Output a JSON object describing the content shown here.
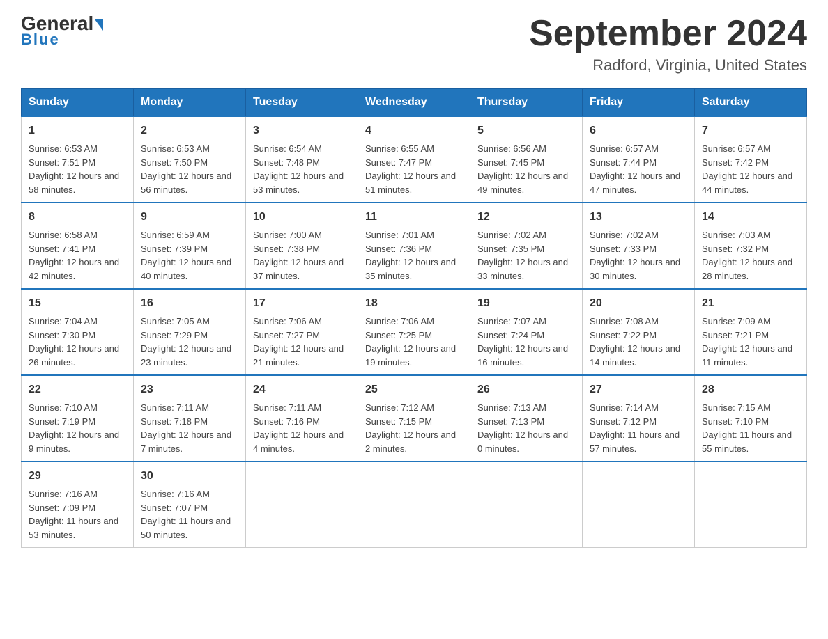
{
  "header": {
    "logo_general": "General",
    "logo_blue": "Blue",
    "month_year": "September 2024",
    "location": "Radford, Virginia, United States"
  },
  "days_of_week": [
    "Sunday",
    "Monday",
    "Tuesday",
    "Wednesday",
    "Thursday",
    "Friday",
    "Saturday"
  ],
  "weeks": [
    [
      {
        "day": "1",
        "sunrise": "6:53 AM",
        "sunset": "7:51 PM",
        "daylight": "12 hours and 58 minutes."
      },
      {
        "day": "2",
        "sunrise": "6:53 AM",
        "sunset": "7:50 PM",
        "daylight": "12 hours and 56 minutes."
      },
      {
        "day": "3",
        "sunrise": "6:54 AM",
        "sunset": "7:48 PM",
        "daylight": "12 hours and 53 minutes."
      },
      {
        "day": "4",
        "sunrise": "6:55 AM",
        "sunset": "7:47 PM",
        "daylight": "12 hours and 51 minutes."
      },
      {
        "day": "5",
        "sunrise": "6:56 AM",
        "sunset": "7:45 PM",
        "daylight": "12 hours and 49 minutes."
      },
      {
        "day": "6",
        "sunrise": "6:57 AM",
        "sunset": "7:44 PM",
        "daylight": "12 hours and 47 minutes."
      },
      {
        "day": "7",
        "sunrise": "6:57 AM",
        "sunset": "7:42 PM",
        "daylight": "12 hours and 44 minutes."
      }
    ],
    [
      {
        "day": "8",
        "sunrise": "6:58 AM",
        "sunset": "7:41 PM",
        "daylight": "12 hours and 42 minutes."
      },
      {
        "day": "9",
        "sunrise": "6:59 AM",
        "sunset": "7:39 PM",
        "daylight": "12 hours and 40 minutes."
      },
      {
        "day": "10",
        "sunrise": "7:00 AM",
        "sunset": "7:38 PM",
        "daylight": "12 hours and 37 minutes."
      },
      {
        "day": "11",
        "sunrise": "7:01 AM",
        "sunset": "7:36 PM",
        "daylight": "12 hours and 35 minutes."
      },
      {
        "day": "12",
        "sunrise": "7:02 AM",
        "sunset": "7:35 PM",
        "daylight": "12 hours and 33 minutes."
      },
      {
        "day": "13",
        "sunrise": "7:02 AM",
        "sunset": "7:33 PM",
        "daylight": "12 hours and 30 minutes."
      },
      {
        "day": "14",
        "sunrise": "7:03 AM",
        "sunset": "7:32 PM",
        "daylight": "12 hours and 28 minutes."
      }
    ],
    [
      {
        "day": "15",
        "sunrise": "7:04 AM",
        "sunset": "7:30 PM",
        "daylight": "12 hours and 26 minutes."
      },
      {
        "day": "16",
        "sunrise": "7:05 AM",
        "sunset": "7:29 PM",
        "daylight": "12 hours and 23 minutes."
      },
      {
        "day": "17",
        "sunrise": "7:06 AM",
        "sunset": "7:27 PM",
        "daylight": "12 hours and 21 minutes."
      },
      {
        "day": "18",
        "sunrise": "7:06 AM",
        "sunset": "7:25 PM",
        "daylight": "12 hours and 19 minutes."
      },
      {
        "day": "19",
        "sunrise": "7:07 AM",
        "sunset": "7:24 PM",
        "daylight": "12 hours and 16 minutes."
      },
      {
        "day": "20",
        "sunrise": "7:08 AM",
        "sunset": "7:22 PM",
        "daylight": "12 hours and 14 minutes."
      },
      {
        "day": "21",
        "sunrise": "7:09 AM",
        "sunset": "7:21 PM",
        "daylight": "12 hours and 11 minutes."
      }
    ],
    [
      {
        "day": "22",
        "sunrise": "7:10 AM",
        "sunset": "7:19 PM",
        "daylight": "12 hours and 9 minutes."
      },
      {
        "day": "23",
        "sunrise": "7:11 AM",
        "sunset": "7:18 PM",
        "daylight": "12 hours and 7 minutes."
      },
      {
        "day": "24",
        "sunrise": "7:11 AM",
        "sunset": "7:16 PM",
        "daylight": "12 hours and 4 minutes."
      },
      {
        "day": "25",
        "sunrise": "7:12 AM",
        "sunset": "7:15 PM",
        "daylight": "12 hours and 2 minutes."
      },
      {
        "day": "26",
        "sunrise": "7:13 AM",
        "sunset": "7:13 PM",
        "daylight": "12 hours and 0 minutes."
      },
      {
        "day": "27",
        "sunrise": "7:14 AM",
        "sunset": "7:12 PM",
        "daylight": "11 hours and 57 minutes."
      },
      {
        "day": "28",
        "sunrise": "7:15 AM",
        "sunset": "7:10 PM",
        "daylight": "11 hours and 55 minutes."
      }
    ],
    [
      {
        "day": "29",
        "sunrise": "7:16 AM",
        "sunset": "7:09 PM",
        "daylight": "11 hours and 53 minutes."
      },
      {
        "day": "30",
        "sunrise": "7:16 AM",
        "sunset": "7:07 PM",
        "daylight": "11 hours and 50 minutes."
      },
      null,
      null,
      null,
      null,
      null
    ]
  ],
  "labels": {
    "sunrise": "Sunrise:",
    "sunset": "Sunset:",
    "daylight": "Daylight:"
  }
}
